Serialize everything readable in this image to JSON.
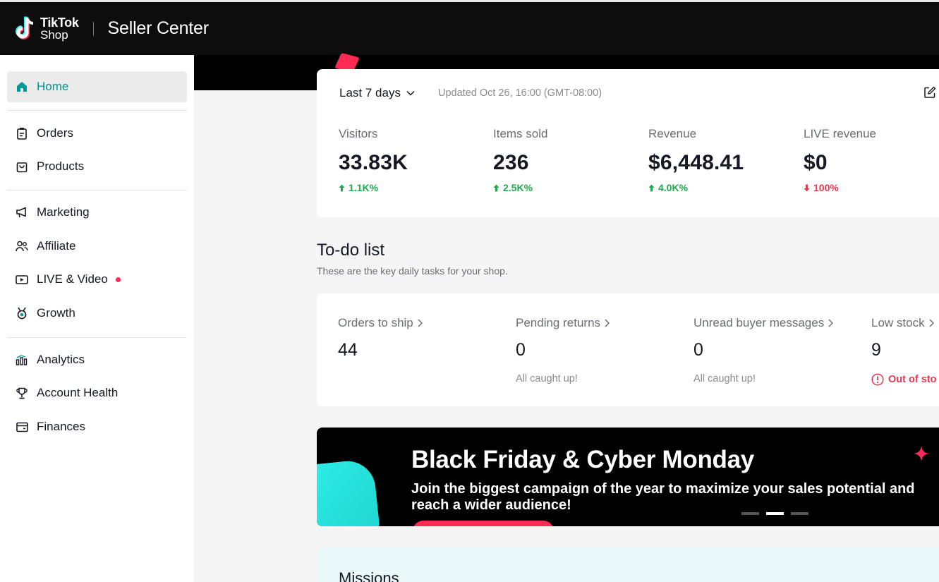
{
  "header": {
    "logo_line1": "TikTok",
    "logo_line2": "Shop",
    "title": "Seller Center"
  },
  "sidebar": {
    "items": [
      {
        "label": "Home",
        "icon": "home-icon"
      },
      {
        "label": "Orders",
        "icon": "clipboard-icon"
      },
      {
        "label": "Products",
        "icon": "bag-icon"
      },
      {
        "label": "Marketing",
        "icon": "megaphone-icon"
      },
      {
        "label": "Affiliate",
        "icon": "people-icon"
      },
      {
        "label": "LIVE & Video",
        "icon": "video-icon"
      },
      {
        "label": "Growth",
        "icon": "medal-icon"
      },
      {
        "label": "Analytics",
        "icon": "bar-chart-icon"
      },
      {
        "label": "Account Health",
        "icon": "trophy-icon"
      },
      {
        "label": "Finances",
        "icon": "wallet-icon"
      }
    ]
  },
  "stats": {
    "period": "Last 7 days",
    "updated": "Updated Oct 26, 16:00 (GMT-08:00)",
    "metrics": [
      {
        "label": "Visitors",
        "value": "33.83K",
        "change": "1.1K%",
        "direction": "up"
      },
      {
        "label": "Items sold",
        "value": "236",
        "change": "2.5K%",
        "direction": "up"
      },
      {
        "label": "Revenue",
        "value": "$6,448.41",
        "change": "4.0K%",
        "direction": "up"
      },
      {
        "label": "LIVE revenue",
        "value": "$0",
        "change": "100%",
        "direction": "down"
      }
    ]
  },
  "todo": {
    "title": "To-do list",
    "subtitle": "These are the key daily tasks for your shop.",
    "tasks": [
      {
        "label": "Orders to ship",
        "value": "44",
        "note": ""
      },
      {
        "label": "Pending returns",
        "value": "0",
        "note": "All caught up!"
      },
      {
        "label": "Unread buyer messages",
        "value": "0",
        "note": "All caught up!"
      },
      {
        "label": "Low stock",
        "value": "9",
        "note": "Out of sto"
      }
    ]
  },
  "banner": {
    "title": "Black Friday & Cyber Monday",
    "text": "Join the biggest campaign of the year to maximize your sales potential and reach a wider audience!",
    "slides": 3,
    "active_slide": 2
  },
  "missions": {
    "title": "Missions"
  },
  "colors": {
    "accent": "#009995",
    "brand_pink": "#fe2c55",
    "brand_cyan": "#25f4ee",
    "up": "#1dab4d",
    "down": "#e8384f"
  }
}
